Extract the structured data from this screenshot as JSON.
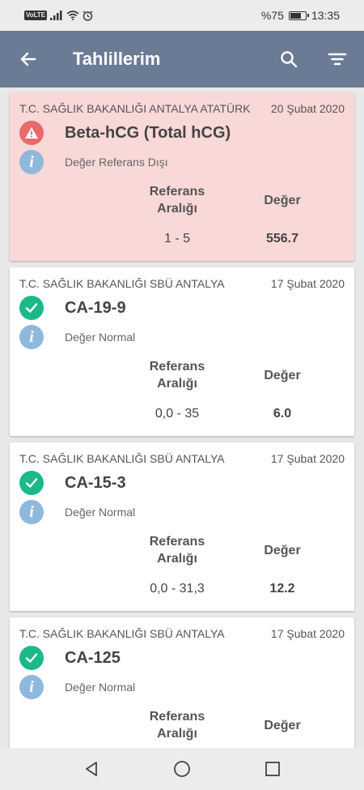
{
  "status_bar": {
    "volte": "VoLTE",
    "battery": "%75",
    "battery_level": 0.75,
    "time": "13:35"
  },
  "app_bar": {
    "title": "Tahlillerim",
    "icons": [
      "back-arrow-icon",
      "search-icon",
      "filter-icon"
    ]
  },
  "results": [
    {
      "hospital": "T.C. SAĞLIK BAKANLIĞI ANTALYA ATATÜRK",
      "date": "20 Şubat 2020",
      "test": "Beta-hCG (Total hCG)",
      "status": "Değer Referans Dışı",
      "ref_header": "Referans Aralığı",
      "value_header": "Değer",
      "ref": "1 - 5",
      "value": "556.7",
      "flag": "warning",
      "bg_color": "#f9d8d8"
    },
    {
      "hospital": "T.C. SAĞLIK BAKANLIĞI SBÜ ANTALYA",
      "date": "17 Şubat 2020",
      "test": "CA-19-9",
      "status": "Değer Normal",
      "ref_header": "Referans Aralığı",
      "value_header": "Değer",
      "ref": "0,0 - 35",
      "value": "6.0",
      "flag": "normal"
    },
    {
      "hospital": "T.C. SAĞLIK BAKANLIĞI SBÜ ANTALYA",
      "date": "17 Şubat 2020",
      "test": "CA-15-3",
      "status": "Değer Normal",
      "ref_header": "Referans Aralığı",
      "value_header": "Değer",
      "ref": "0,0 - 31,3",
      "value": "12.2",
      "flag": "normal"
    },
    {
      "hospital": "T.C. SAĞLIK BAKANLIĞI SBÜ ANTALYA",
      "date": "17 Şubat 2020",
      "test": "CA-125",
      "status": "Değer Normal",
      "ref_header": "Referans Aralığı",
      "value_header": "Değer",
      "flag": "normal"
    }
  ],
  "nav_bar": {
    "icons": [
      "back-triangle-icon",
      "home-circle-icon",
      "recents-square-icon"
    ]
  },
  "info_icon_glyph": "i",
  "colors": {
    "app_bar": "#6b7b96",
    "alert_bg": "#f9d8d8",
    "warning_red": "#e86a6a",
    "normal_green": "#1db88a",
    "info_blue": "#8fb8dc"
  }
}
